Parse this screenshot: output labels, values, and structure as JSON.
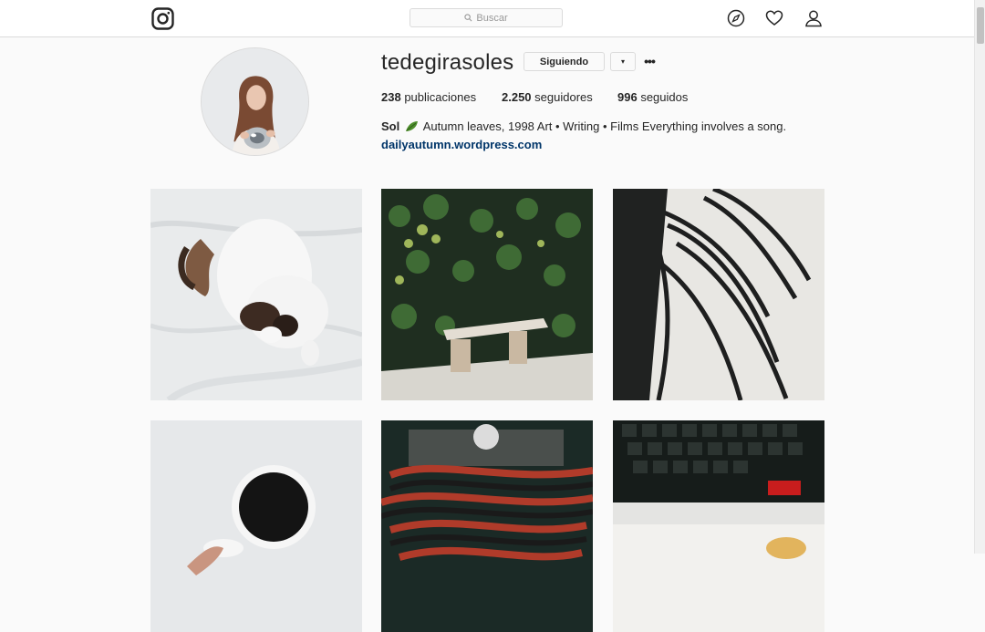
{
  "nav": {
    "logo_icon": "instagram-logo-icon",
    "search_placeholder": "Buscar",
    "icons": [
      "compass-icon",
      "heart-icon",
      "person-icon"
    ]
  },
  "profile": {
    "username": "tedegirasoles",
    "follow_label": "Siguiendo",
    "dropdown_symbol": "▾",
    "more_symbol": "•••",
    "stats": {
      "posts_count": "238",
      "posts_label": "publicaciones",
      "followers_count": "2.250",
      "followers_label": "seguidores",
      "following_count": "996",
      "following_label": "seguidos"
    },
    "bio": {
      "name": "Sol",
      "emoji_icon": "leaf-icon",
      "text": "Autumn leaves, 1998 Art • Writing • Films Everything involves a song.",
      "link": "dailyautumn.wordpress.com"
    }
  },
  "posts": [
    {
      "subject": "white cat on bedsheet"
    },
    {
      "subject": "stone bench with hedge"
    },
    {
      "subject": "palm leaf shadow"
    },
    {
      "subject": "cup of coffee"
    },
    {
      "subject": "typewriter and red scarf"
    },
    {
      "subject": "keyboard and flowers"
    }
  ],
  "colors": {
    "background": "#fafafa",
    "border": "#dbdbdb",
    "text": "#262626",
    "link": "#003569"
  }
}
